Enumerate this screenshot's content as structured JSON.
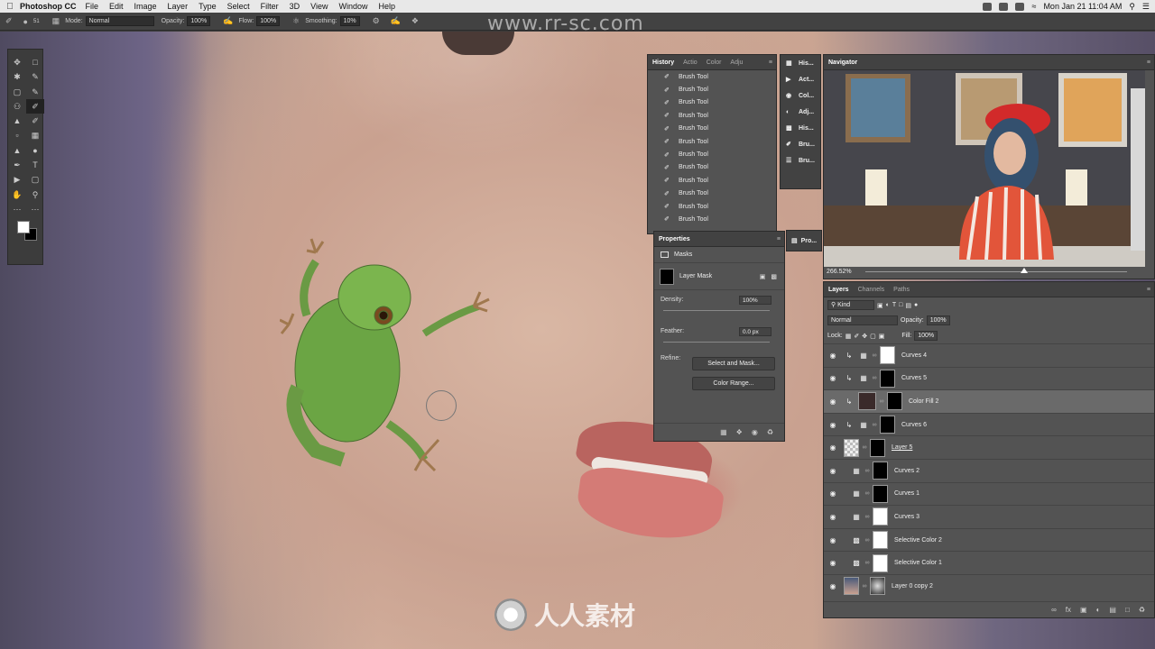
{
  "menubar": {
    "app": "Photoshop CC",
    "menus": [
      "File",
      "Edit",
      "Image",
      "Layer",
      "Type",
      "Select",
      "Filter",
      "3D",
      "View",
      "Window",
      "Help"
    ],
    "clock": "Mon Jan 21  11:04 AM"
  },
  "watermark": {
    "top": "www.rr-sc.com",
    "bottom": "人人素材"
  },
  "options": {
    "brush_size": "51",
    "mode_label": "Mode:",
    "mode_value": "Normal",
    "opacity_label": "Opacity:",
    "opacity_value": "100%",
    "flow_label": "Flow:",
    "flow_value": "100%",
    "smoothing_label": "Smoothing:",
    "smoothing_value": "10%"
  },
  "history": {
    "tabs": [
      "History",
      "Actio",
      "Color",
      "Adju"
    ],
    "items": [
      "Brush Tool",
      "Brush Tool",
      "Brush Tool",
      "Brush Tool",
      "Brush Tool",
      "Brush Tool",
      "Brush Tool",
      "Brush Tool",
      "Brush Tool",
      "Brush Tool",
      "Brush Tool",
      "Brush Tool"
    ]
  },
  "mini_panels": [
    "His...",
    "Act...",
    "Col...",
    "Adj...",
    "His...",
    "Bru...",
    "Bru..."
  ],
  "mini_panel_2": "Pro...",
  "properties": {
    "title": "Properties",
    "section": "Masks",
    "mask_label": "Layer Mask",
    "density_label": "Density:",
    "density_value": "100%",
    "feather_label": "Feather:",
    "feather_value": "0.0 px",
    "refine_label": "Refine:",
    "select_mask_button": "Select and Mask...",
    "color_range_button": "Color Range..."
  },
  "navigator": {
    "title": "Navigator",
    "zoom": "266.52%"
  },
  "layers": {
    "tabs": [
      "Layers",
      "Channels",
      "Paths"
    ],
    "kind": "Kind",
    "blend_mode": "Normal",
    "opacity_label": "Opacity:",
    "opacity_value": "100%",
    "lock_label": "Lock:",
    "fill_label": "Fill:",
    "fill_value": "100%",
    "items": [
      {
        "name": "Curves 4",
        "thumb": "white",
        "selected": false
      },
      {
        "name": "Curves 5",
        "thumb": "black",
        "selected": false
      },
      {
        "name": "Color Fill 2",
        "thumb": "black",
        "selected": true
      },
      {
        "name": "Curves 6",
        "thumb": "black",
        "selected": false
      },
      {
        "name": "Layer 5",
        "thumb": "black",
        "selected": false
      },
      {
        "name": "Curves 2",
        "thumb": "black",
        "selected": false
      },
      {
        "name": "Curves 1",
        "thumb": "black",
        "selected": false
      },
      {
        "name": "Curves 3",
        "thumb": "white",
        "selected": false
      },
      {
        "name": "Selective Color 2",
        "thumb": "white",
        "selected": false
      },
      {
        "name": "Selective Color 1",
        "thumb": "white",
        "selected": false
      },
      {
        "name": "Layer 0 copy 2",
        "thumb": "photo",
        "selected": false
      }
    ]
  },
  "colors": {
    "panel": "#535353",
    "selected_row": "#6a6a6a",
    "fill_swatch": "#3a2a2a"
  }
}
